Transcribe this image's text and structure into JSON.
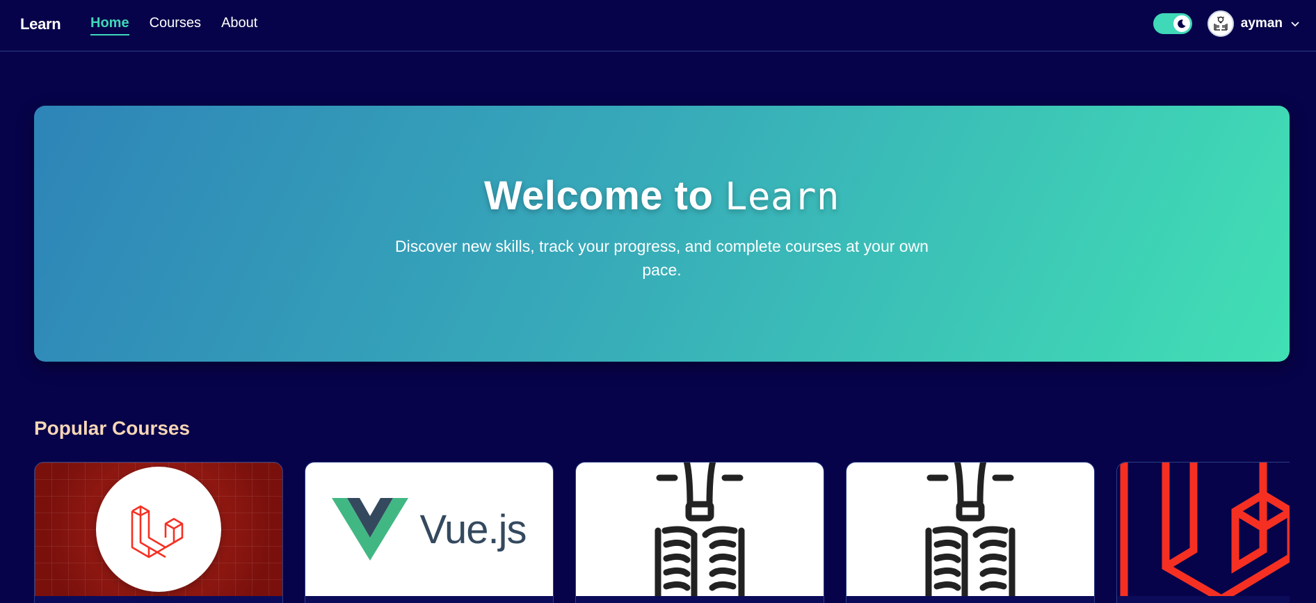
{
  "header": {
    "brand": "Learn",
    "nav": [
      {
        "label": "Home",
        "active": true
      },
      {
        "label": "Courses",
        "active": false
      },
      {
        "label": "About",
        "active": false
      }
    ],
    "theme_toggle": {
      "state": "dark",
      "icon": "moon-icon"
    },
    "user": {
      "name": "ayman",
      "avatar_icon": "book-lightbulb-icon"
    }
  },
  "hero": {
    "title_prefix": "Welcome to",
    "title_brand": "Learn",
    "subtitle": "Discover new skills, track your progress, and complete courses at your own pace."
  },
  "popular": {
    "title": "Popular Courses",
    "cards": [
      {
        "thumb": "laravel-logo"
      },
      {
        "thumb": "vuejs-logo",
        "logo_text": "Vue.js"
      },
      {
        "thumb": "book-lightbulb-icon"
      },
      {
        "thumb": "book-lightbulb-icon"
      },
      {
        "thumb": "laravel-logo-large"
      }
    ]
  },
  "colors": {
    "background": "#07034a",
    "accent": "#3fd8b8",
    "section_title": "#f6d6b6",
    "laravel_red": "#f53022",
    "vue_green": "#41b883",
    "vue_dark": "#34495e"
  }
}
